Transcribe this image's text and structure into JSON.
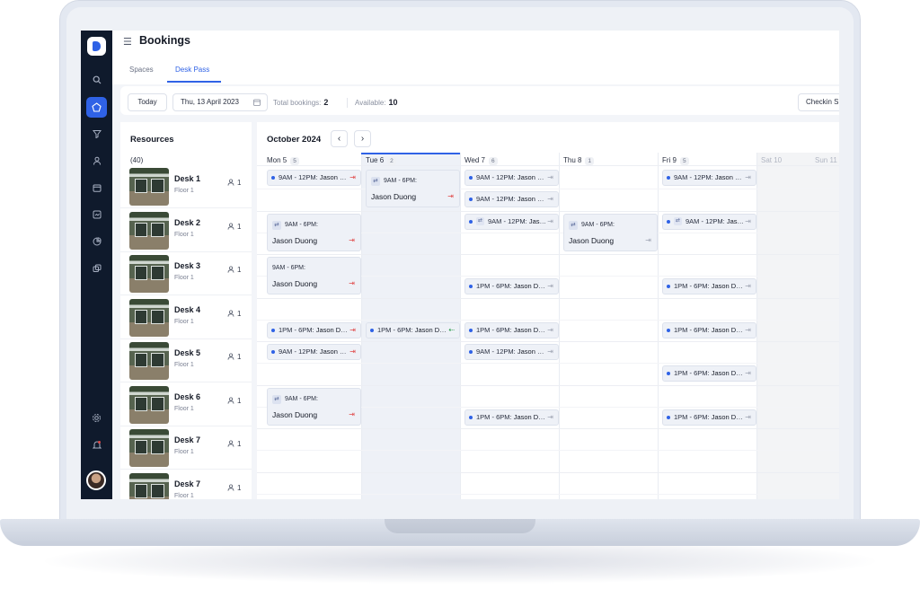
{
  "app": {
    "page_title": "Bookings",
    "tabs": [
      {
        "label": "Spaces",
        "active": false
      },
      {
        "label": "Desk Pass",
        "active": true
      }
    ]
  },
  "sidebar": {
    "icons": [
      "logo-icon",
      "search-icon",
      "spaces-icon",
      "filter-icon",
      "user-icon",
      "calendar-icon",
      "schedule-icon",
      "report-icon",
      "layers-icon",
      "settings-icon",
      "notification-icon"
    ]
  },
  "toolbar": {
    "today_label": "Today",
    "date_value": "Thu, 13 April 2023",
    "total_label": "Total bookings:",
    "total_value": "2",
    "available_label": "Available:",
    "available_value": "10",
    "checkin_label": "Checkin S"
  },
  "resources": {
    "title": "Resources",
    "count": "(40)",
    "items": [
      {
        "name": "Desk 1",
        "floor": "Floor 1",
        "capacity": "1"
      },
      {
        "name": "Desk 2",
        "floor": "Floor 1",
        "capacity": "1"
      },
      {
        "name": "Desk 3",
        "floor": "Floor 1",
        "capacity": "1"
      },
      {
        "name": "Desk 4",
        "floor": "Floor 1",
        "capacity": "1"
      },
      {
        "name": "Desk 5",
        "floor": "Floor 1",
        "capacity": "1"
      },
      {
        "name": "Desk 6",
        "floor": "Floor 1",
        "capacity": "1"
      },
      {
        "name": "Desk 7",
        "floor": "Floor 1",
        "capacity": "1"
      },
      {
        "name": "Desk 7",
        "floor": "Floor 1",
        "capacity": "1"
      }
    ]
  },
  "calendar": {
    "month": "October 2024",
    "prev_label": "‹",
    "next_label": "›",
    "days": [
      {
        "label": "Mon 5",
        "count": "5"
      },
      {
        "label": "Tue 6",
        "count": "2"
      },
      {
        "label": "Wed 7",
        "count": "6"
      },
      {
        "label": "Thu 8",
        "count": "1"
      },
      {
        "label": "Fri 9",
        "count": "5"
      },
      {
        "label": "Sat 10",
        "count": ""
      },
      {
        "label": "Sun 11",
        "count": ""
      }
    ],
    "bookings": [
      {
        "day": 0,
        "row": 0,
        "slot": 0,
        "kind": "pill",
        "time": "9AM - 12PM:",
        "name": "Jason Duong",
        "state": "out"
      },
      {
        "day": 0,
        "row": 1,
        "slot": 0,
        "kind": "card",
        "recurring": true,
        "time": "9AM - 6PM:",
        "name": "Jason Duong",
        "state": "out"
      },
      {
        "day": 0,
        "row": 2,
        "slot": 0,
        "kind": "card",
        "recurring": false,
        "time": "9AM - 6PM:",
        "name": "Jason Duong",
        "state": "out"
      },
      {
        "day": 0,
        "row": 3,
        "slot": 1,
        "kind": "pill",
        "time": "1PM - 6PM:",
        "name": "Jason Duong",
        "state": "out"
      },
      {
        "day": 0,
        "row": 4,
        "slot": 0,
        "kind": "pill",
        "time": "9AM - 12PM:",
        "name": "Jason Duong",
        "state": "out"
      },
      {
        "day": 0,
        "row": 5,
        "slot": 0,
        "kind": "card",
        "recurring": true,
        "time": "9AM - 6PM:",
        "name": "Jason Duong",
        "state": "out"
      },
      {
        "day": 1,
        "row": 0,
        "slot": 0,
        "kind": "card",
        "recurring": true,
        "time": "9AM - 6PM:",
        "name": "Jason Duong",
        "state": "out"
      },
      {
        "day": 1,
        "row": 3,
        "slot": 1,
        "kind": "pill",
        "time": "1PM - 6PM:",
        "name": "Jason Duong",
        "state": "in"
      },
      {
        "day": 2,
        "row": 0,
        "slot": 0,
        "kind": "pill",
        "time": "9AM - 12PM:",
        "name": "Jason Duong",
        "state": "idle"
      },
      {
        "day": 2,
        "row": 0,
        "slot": 1,
        "kind": "pill",
        "time": "9AM - 12PM:",
        "name": "Jason Duong",
        "state": "idle"
      },
      {
        "day": 2,
        "row": 1,
        "slot": 0,
        "kind": "pill",
        "recurring": true,
        "time": "9AM - 12PM:",
        "name": "Jason Duong",
        "state": "idle"
      },
      {
        "day": 2,
        "row": 2,
        "slot": 1,
        "kind": "pill",
        "time": "1PM - 6PM:",
        "name": "Jason Duong",
        "state": "idle"
      },
      {
        "day": 2,
        "row": 3,
        "slot": 1,
        "kind": "pill",
        "time": "1PM - 6PM:",
        "name": "Jason Duong",
        "state": "idle"
      },
      {
        "day": 2,
        "row": 4,
        "slot": 0,
        "kind": "pill",
        "time": "9AM - 12PM:",
        "name": "Jason Duong",
        "state": "idle"
      },
      {
        "day": 2,
        "row": 5,
        "slot": 1,
        "kind": "pill",
        "time": "1PM - 6PM:",
        "name": "Jason Duong",
        "state": "idle"
      },
      {
        "day": 3,
        "row": 1,
        "slot": 0,
        "kind": "card",
        "recurring": true,
        "time": "9AM - 6PM:",
        "name": "Jason Duong",
        "state": "idle"
      },
      {
        "day": 4,
        "row": 0,
        "slot": 0,
        "kind": "pill",
        "time": "9AM - 12PM:",
        "name": "Jason Duong",
        "state": "idle"
      },
      {
        "day": 4,
        "row": 1,
        "slot": 0,
        "kind": "pill",
        "recurring": true,
        "time": "9AM - 12PM:",
        "name": "Jason Duong",
        "state": "idle"
      },
      {
        "day": 4,
        "row": 2,
        "slot": 1,
        "kind": "pill",
        "time": "1PM - 6PM:",
        "name": "Jason Duong",
        "state": "idle"
      },
      {
        "day": 4,
        "row": 3,
        "slot": 1,
        "kind": "pill",
        "time": "1PM - 6PM:",
        "name": "Jason Duong",
        "state": "idle"
      },
      {
        "day": 4,
        "row": 4,
        "slot": 1,
        "kind": "pill",
        "time": "1PM - 6PM:",
        "name": "Jason Duong",
        "state": "idle"
      },
      {
        "day": 4,
        "row": 5,
        "slot": 1,
        "kind": "pill",
        "time": "1PM - 6PM:",
        "name": "Jason Duong",
        "state": "idle"
      }
    ]
  },
  "colors": {
    "accent": "#2f62e6",
    "sidebar": "#0f1a2c",
    "checkout": "#e04a4a",
    "checkin": "#2e9e4f"
  }
}
